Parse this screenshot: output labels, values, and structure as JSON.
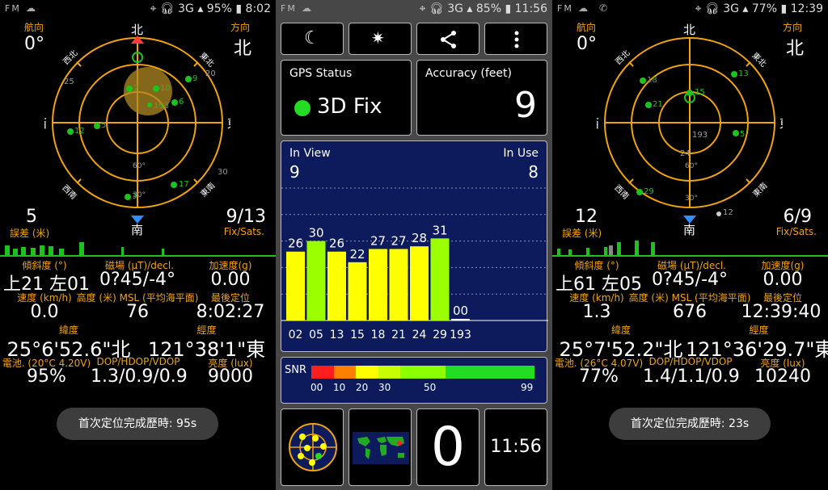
{
  "left": {
    "status": {
      "left": "FM",
      "time": "8:02",
      "signal": "3G",
      "battery": "95%"
    },
    "heading": {
      "label": "航向",
      "value": "0°"
    },
    "direction": {
      "label": "方向",
      "value": "北"
    },
    "compass": {
      "north": "北",
      "east": "東",
      "south": "南",
      "west": "西",
      "ne": "東北",
      "nw": "西北",
      "se": "東南",
      "sw": "西南",
      "ring1": "30°",
      "ring2": "60°"
    },
    "sats": [
      {
        "id": "2",
        "color": "#1ec21e"
      },
      {
        "id": "10",
        "color": "#1ec21e"
      },
      {
        "id": "9",
        "color": "#1ec21e"
      },
      {
        "id": "6",
        "color": "#1ec21e"
      },
      {
        "id": "193",
        "color": "#1ec21e"
      },
      {
        "id": "5",
        "color": "#1ec21e"
      },
      {
        "id": "12",
        "color": "#1ec21e"
      },
      {
        "id": "17",
        "color": "#1ec21e"
      },
      {
        "id": "3",
        "color": "#1ec21e"
      },
      {
        "id": "25",
        "color": "#999"
      },
      {
        "id": "20",
        "color": "#999"
      },
      {
        "id": "30",
        "color": "#999"
      }
    ],
    "error": {
      "value": "5",
      "label": "誤差 (米)"
    },
    "fix": {
      "value": "9/13",
      "label": "Fix/Sats."
    },
    "tilt": {
      "label": "傾斜度 (°)",
      "value": "上21 左01"
    },
    "magnetic": {
      "label": "磁場 (μT)/decl.",
      "value": "0?45/-4°"
    },
    "accel": {
      "label": "加速度(g)",
      "value": "0.00"
    },
    "speed": {
      "label": "速度 (km/h)",
      "value": "0.0"
    },
    "altitude": {
      "label": "高度 (米) MSL (平均海平面)",
      "value": "76"
    },
    "last_fix": {
      "label": "最後定位",
      "value": "8:02:27"
    },
    "latitude": {
      "label": "緯度",
      "value": "25°6'52.6\"北"
    },
    "longitude": {
      "label": "經度",
      "value": "121°38'1\"東"
    },
    "battery": {
      "label": "電池. (20°C 4.20V)",
      "value": "95%"
    },
    "dop": {
      "label": "DOP/HDOP/VDOP",
      "value": "1.3/0.9/0.9"
    },
    "brightness": {
      "label": "亮度 (lux)",
      "value": "9000"
    },
    "ttff": {
      "label": "首次定位完成歷時:",
      "value": "95s"
    }
  },
  "middle": {
    "status": {
      "left": "FM",
      "time": "11:56",
      "signal": "3G",
      "battery": "85%"
    },
    "gps_status": {
      "title": "GPS Status",
      "value": "3D Fix",
      "dot_color": "#22dd22"
    },
    "accuracy": {
      "title": "Accuracy (feet)",
      "value": "9"
    },
    "sky": {
      "in_view_label": "In View",
      "in_view": "9",
      "in_use_label": "In Use",
      "in_use": "8"
    },
    "chart_data": {
      "type": "bar",
      "categories": [
        "02",
        "05",
        "13",
        "15",
        "18",
        "21",
        "24",
        "29",
        "193"
      ],
      "values": [
        26,
        30,
        26,
        22,
        27,
        27,
        28,
        31,
        0
      ],
      "ylim": [
        0,
        50
      ]
    },
    "snr": {
      "label": "SNR",
      "ticks": [
        "00",
        "10",
        "20",
        "30",
        "50",
        "99"
      ]
    },
    "bottom": {
      "counter": "0",
      "clock": "11:56"
    }
  },
  "right": {
    "status": {
      "left": "FM",
      "time": "12:39",
      "signal": "3G",
      "battery": "77%"
    },
    "heading": {
      "label": "航向",
      "value": "0°"
    },
    "direction": {
      "label": "方向",
      "value": "北"
    },
    "compass": {
      "north": "北",
      "east": "東",
      "south": "南",
      "west": "西",
      "ne": "東北",
      "nw": "西北",
      "se": "東南",
      "sw": "西南",
      "ring1": "30°",
      "ring2": "60°"
    },
    "sats": [
      {
        "id": "18",
        "color": "#1ec21e"
      },
      {
        "id": "13",
        "color": "#1ec21e"
      },
      {
        "id": "15",
        "color": "#1ec21e"
      },
      {
        "id": "21",
        "color": "#1ec21e"
      },
      {
        "id": "5",
        "color": "#1ec21e"
      },
      {
        "id": "29",
        "color": "#1ec21e"
      },
      {
        "id": "193",
        "color": "#999"
      },
      {
        "id": "24",
        "color": "#999"
      },
      {
        "id": "12",
        "color": "#999"
      }
    ],
    "error": {
      "value": "12",
      "label": "誤差 (米)"
    },
    "fix": {
      "value": "6/9",
      "label": "Fix/Sats."
    },
    "tilt": {
      "label": "傾斜度 (°)",
      "value": "上61 左05"
    },
    "magnetic": {
      "label": "磁場 (μT)/decl.",
      "value": "0?45/-4°"
    },
    "accel": {
      "label": "加速度(g)",
      "value": "0.00"
    },
    "speed": {
      "label": "速度 (km/h)",
      "value": "1.3"
    },
    "altitude": {
      "label": "高度 (米) MSL (平均海平面)",
      "value": "676"
    },
    "last_fix": {
      "label": "最後定位",
      "value": "12:39:40"
    },
    "latitude": {
      "label": "緯度",
      "value": "25°7'52.2\"北"
    },
    "longitude": {
      "label": "經度",
      "value": "121°36'29.7\"東"
    },
    "battery": {
      "label": "電池. (26°C 4.07V)",
      "value": "77%"
    },
    "dop": {
      "label": "DOP/HDOP/VDOP",
      "value": "1.4/1.1/0.9"
    },
    "brightness": {
      "label": "亮度 (lux)",
      "value": "10240"
    },
    "ttff": {
      "label": "首次定位完成歷時:",
      "value": "23s"
    }
  }
}
